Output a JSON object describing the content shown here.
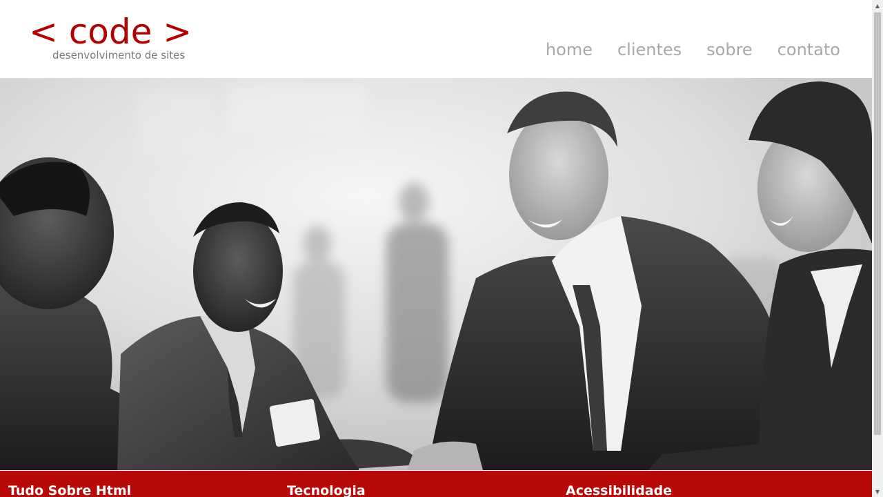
{
  "logo": {
    "main": "< code >",
    "tagline": "desenvolvimento de sites"
  },
  "nav": {
    "items": [
      {
        "label": "home"
      },
      {
        "label": "clientes"
      },
      {
        "label": "sobre"
      },
      {
        "label": "contato"
      }
    ]
  },
  "hero": {
    "image": "business-people-handshake-photo"
  },
  "topics": {
    "items": [
      {
        "label": "Tudo Sobre Html"
      },
      {
        "label": "Tecnologia"
      },
      {
        "label": "Acessibilidade"
      }
    ]
  },
  "colors": {
    "brand_red": "#b40000",
    "bar_red": "#b80808",
    "nav_gray": "#a8a8a8",
    "tagline_gray": "#7a7a7a"
  }
}
